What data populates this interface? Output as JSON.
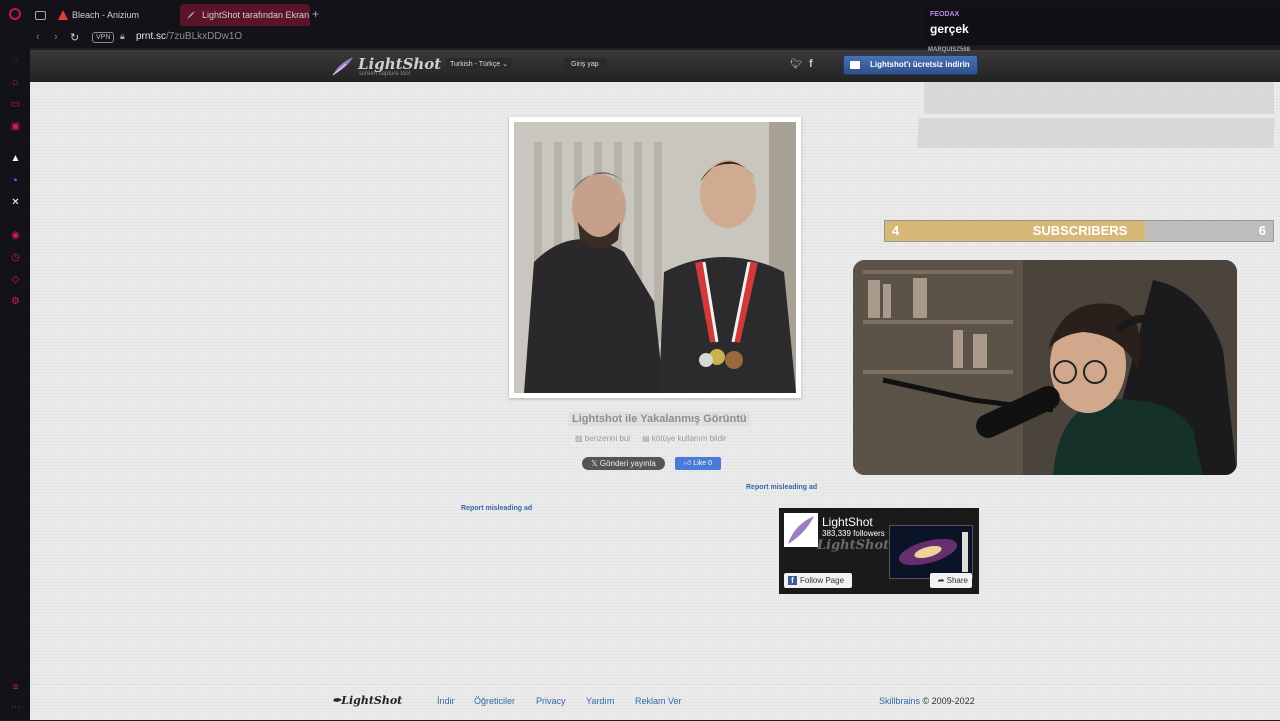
{
  "browser": {
    "tabs": [
      {
        "label": "Bleach - Anizium"
      },
      {
        "label": "LightShot tarafından Ekran"
      }
    ],
    "new_tab": "+",
    "vpn": "VPN",
    "url_host": "prnt.sc",
    "url_path": "/7zuBLkxDDw1O"
  },
  "lightshot": {
    "logo_name": "LightShot",
    "logo_tagline": "screen capture tool",
    "language": "Turkish - Türkçe",
    "login": "Giriş yap",
    "download": "Lightshot'ı ücretsiz indirin",
    "screenshot_title": "Lightshot ile Yakalanmış Görüntü",
    "find_similar": "benzerini bul",
    "report_abuse": "kötüye kullanım bildir",
    "tweet": "Gönderi yayınla",
    "like": "Like 0",
    "report_ad_1": "Report misleading ad",
    "report_ad_2": "Report misleading ad"
  },
  "facebook_widget": {
    "page_name": "LightShot",
    "followers": "383,339 followers",
    "watermark": "LightShot",
    "follow": "Follow Page",
    "share": "Share"
  },
  "footer": {
    "logo": "LightShot",
    "links": [
      "İndir",
      "Öğreticiler",
      "Privacy",
      "Yardım",
      "Reklam Ver"
    ],
    "company": "Skillbrains",
    "copyright": "© 2009-2022"
  },
  "stream_overlay": {
    "chat_user": "FEODAX",
    "chat_message": "gerçek",
    "chat_user_2": "MARQUISZ568",
    "subscribers_label": "SUBSCRIBERS",
    "subscribers_current": "4",
    "subscribers_goal": "6",
    "subscribers_progress": 0.67
  },
  "colors": {
    "accent": "#d01e48",
    "subscriber_fill": "#d8b877",
    "link": "#3566a8"
  }
}
